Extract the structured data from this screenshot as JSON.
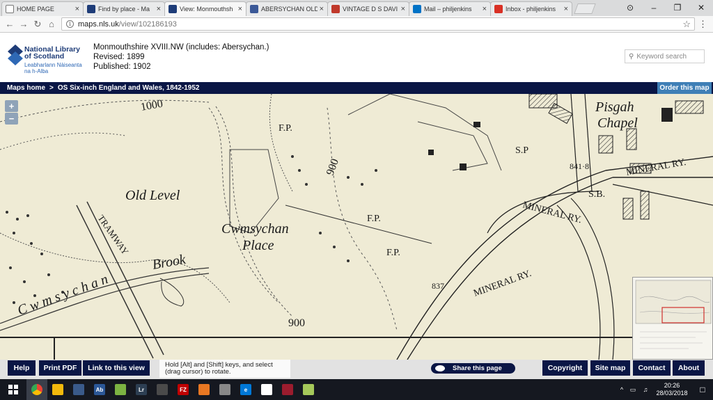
{
  "browser": {
    "tabs": [
      {
        "label": "HOME PAGE",
        "icon": "document-icon",
        "color": "#ffffff",
        "active": false
      },
      {
        "label": "Find by place - Ma",
        "icon": "map-site-icon",
        "color": "#1e3c78",
        "active": false
      },
      {
        "label": "View: Monmouthsh",
        "icon": "map-site-icon",
        "color": "#1e3c78",
        "active": true
      },
      {
        "label": "ABERSYCHAN OLD",
        "icon": "facebook-icon",
        "color": "#3b5998",
        "active": false
      },
      {
        "label": "VINTAGE D S DAVI",
        "icon": "photo-icon",
        "color": "#c0392b",
        "active": false
      },
      {
        "label": "Mail – philjenkins",
        "icon": "outlook-icon",
        "color": "#0072c6",
        "active": false
      },
      {
        "label": "Inbox - philjenkins",
        "icon": "gmail-icon",
        "color": "#d93025",
        "active": false
      }
    ],
    "tab_close": "×",
    "window_controls": {
      "user": "⊙",
      "minimize": "–",
      "restore": "❐",
      "close": "✕"
    },
    "nav": {
      "back": "←",
      "forward": "→",
      "reload": "↻",
      "home": "⌂"
    },
    "url_host": "maps.nls.uk",
    "url_path": "/view/102186193",
    "info_glyph": "i",
    "star": "☆",
    "menu": "⋮"
  },
  "site": {
    "logo": {
      "line1": "National Library",
      "line2": "of Scotland",
      "gaelic1": "Leabharlann Nàiseanta",
      "gaelic2": "na h-Alba"
    },
    "map_title": "Monmouthshire XVIII.NW (includes: Abersychan.)",
    "revised": "Revised: 1899",
    "published": "Published: 1902",
    "search_placeholder": "Keyword search",
    "search_icon_glyph": "⚲",
    "breadcrumb": {
      "home": "Maps home",
      "separator": ">",
      "current": "OS Six-inch England and Wales, 1842-1952"
    },
    "order_button": "Order this map"
  },
  "map": {
    "zoom_in": "+",
    "zoom_out": "−",
    "labels": {
      "pisgah": "Pisgah",
      "chapel": "Chapel",
      "old_level": "Old Level",
      "cwmsychan": "Cwmsychan",
      "place": "Place",
      "tramway": "TRAMWAY",
      "brook": "Brook",
      "cwm": "C w m s y c h a n",
      "fp1": "F.P.",
      "fp2": "F.P.",
      "fp3": "F.P.",
      "sp": "S.P",
      "sb": "S.B.",
      "mineral1": "MINERAL RY.",
      "mineral2": "MINERAL RY.",
      "mineral3": "MINERAL RY.",
      "c1000": "1000",
      "c900a": "900",
      "c900b": "900",
      "h8418": "841·8",
      "h837": "837"
    }
  },
  "footer": {
    "help": "Help",
    "print_pdf": "Print PDF",
    "link": "Link to this view",
    "hint_line1": "Hold [Alt] and [Shift] keys, and select",
    "hint_line2": "(drag cursor) to rotate.",
    "share": "Share this page",
    "copyright": "Copyright",
    "sitemap": "Site map",
    "contact": "Contact",
    "about": "About"
  },
  "taskbar": {
    "apps": [
      {
        "name": "chrome",
        "label": "",
        "color": "#34a853"
      },
      {
        "name": "maps-app",
        "label": "",
        "color": "#f2b90c"
      },
      {
        "name": "calculator-app",
        "label": "",
        "color": "#3a5a8a"
      },
      {
        "name": "dictionary-app",
        "label": "Ab",
        "color": "#2b5797"
      },
      {
        "name": "sketch-app",
        "label": "",
        "color": "#7cb342"
      },
      {
        "name": "lightroom-app",
        "label": "Lr",
        "color": "#2d3f53"
      },
      {
        "name": "files-app",
        "label": "",
        "color": "#4a4a4a"
      },
      {
        "name": "filezilla-app",
        "label": "FZ",
        "color": "#bf0000"
      },
      {
        "name": "presenter-app",
        "label": "",
        "color": "#e87722"
      },
      {
        "name": "disk-app",
        "label": "",
        "color": "#888888"
      },
      {
        "name": "edge-app",
        "label": "e",
        "color": "#0078d7"
      },
      {
        "name": "solitaire-app",
        "label": "",
        "color": "#ffffff"
      },
      {
        "name": "puzzle-app",
        "label": "",
        "color": "#9b1c2e"
      },
      {
        "name": "spreadsheet-app",
        "label": "",
        "color": "#a5c85a"
      }
    ],
    "time": "20:26",
    "date": "28/03/2018"
  }
}
